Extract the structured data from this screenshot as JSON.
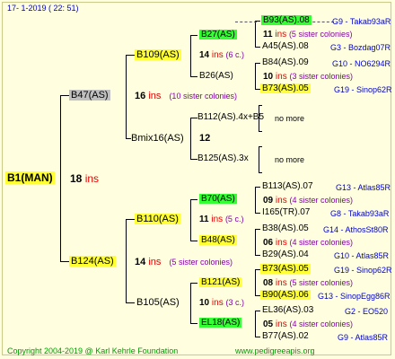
{
  "header": "17-   1-2019  ( 22: 51)",
  "footer": {
    "copyright": "Copyright 2004-2019 @ Karl Kehrle Foundation",
    "url": "www.pedigreeapis.org"
  },
  "colors": {
    "ins": "#e40000",
    "sisters": "#8800aa",
    "code": "#0000cc",
    "yellow": "#ffff33",
    "green": "#33ff33",
    "gray": "#c0c0c0",
    "footer": "#009900"
  },
  "root": {
    "name": "B1(MAN)",
    "year": "18",
    "ins": "ins"
  },
  "g1": [
    {
      "name": "B47(AS)",
      "year": "16",
      "ins": "ins",
      "sisters": "(10 sister colonies)"
    },
    {
      "name": "B124(AS)",
      "year": "14",
      "ins": "ins",
      "sisters": "(5 sister colonies)"
    }
  ],
  "g2": [
    {
      "name": "B109(AS)",
      "year": "14",
      "ins": "ins",
      "sisters": "(6 c.)"
    },
    {
      "name": "Bmix16(AS)",
      "year": "12"
    },
    {
      "name": "B110(AS)",
      "year": "11",
      "ins": "ins",
      "sisters": "(5 c.)"
    },
    {
      "name": "B105(AS)",
      "year": "10",
      "ins": "ins",
      "sisters": "(3 c.)"
    }
  ],
  "g3": [
    {
      "name": "B27(AS)"
    },
    {
      "name": "B26(AS)"
    },
    {
      "name": "B112(AS).4x+B5",
      "note": "no more"
    },
    {
      "name": "B125(AS).3x",
      "note": "no more"
    },
    {
      "name": "B70(AS)"
    },
    {
      "name": "B48(AS)"
    },
    {
      "name": "B121(AS)"
    },
    {
      "name": "EL18(AS)"
    }
  ],
  "g4": [
    {
      "top": "B93(AS).08",
      "topcode": "G9 - Takab93aR",
      "year": "11",
      "ins": "ins",
      "sisters": "(5 sister colonies)",
      "bottom": "A45(AS).08",
      "bottomcode": "G3 - Bozdag07R"
    },
    {
      "top": "B84(AS).09",
      "topcode": "G10 - NO6294R",
      "year": "10",
      "ins": "ins",
      "sisters": "(3 sister colonies)",
      "bottom": "B73(AS).05",
      "bottomcode": "G19 - Sinop62R"
    },
    {
      "top": "B113(AS).07",
      "topcode": "G13 - Atlas85R",
      "year": "09",
      "ins": "ins",
      "sisters": "(4 sister colonies)",
      "bottom": "I165(TR).07",
      "bottomcode": "G8 - Takab93aR"
    },
    {
      "top": "B38(AS).05",
      "topcode": "G14 - AthosSt80R",
      "year": "06",
      "ins": "ins",
      "sisters": "(4 sister colonies)",
      "bottom": "B29(AS).04",
      "bottomcode": "G10 - Atlas85R"
    },
    {
      "top": "B73(AS).05",
      "topcode": "G19 - Sinop62R",
      "year": "08",
      "ins": "ins",
      "sisters": "(5 sister colonies)",
      "bottom": "B90(AS).06",
      "bottomcode": "G13 - SinopEgg86R"
    },
    {
      "top": "EL36(AS).03",
      "topcode": "G2 - EO520",
      "year": "05",
      "ins": "ins",
      "sisters": "(4 sister colonies)",
      "bottom": "B77(AS).02",
      "bottomcode": "G9 - Atlas85R"
    }
  ]
}
